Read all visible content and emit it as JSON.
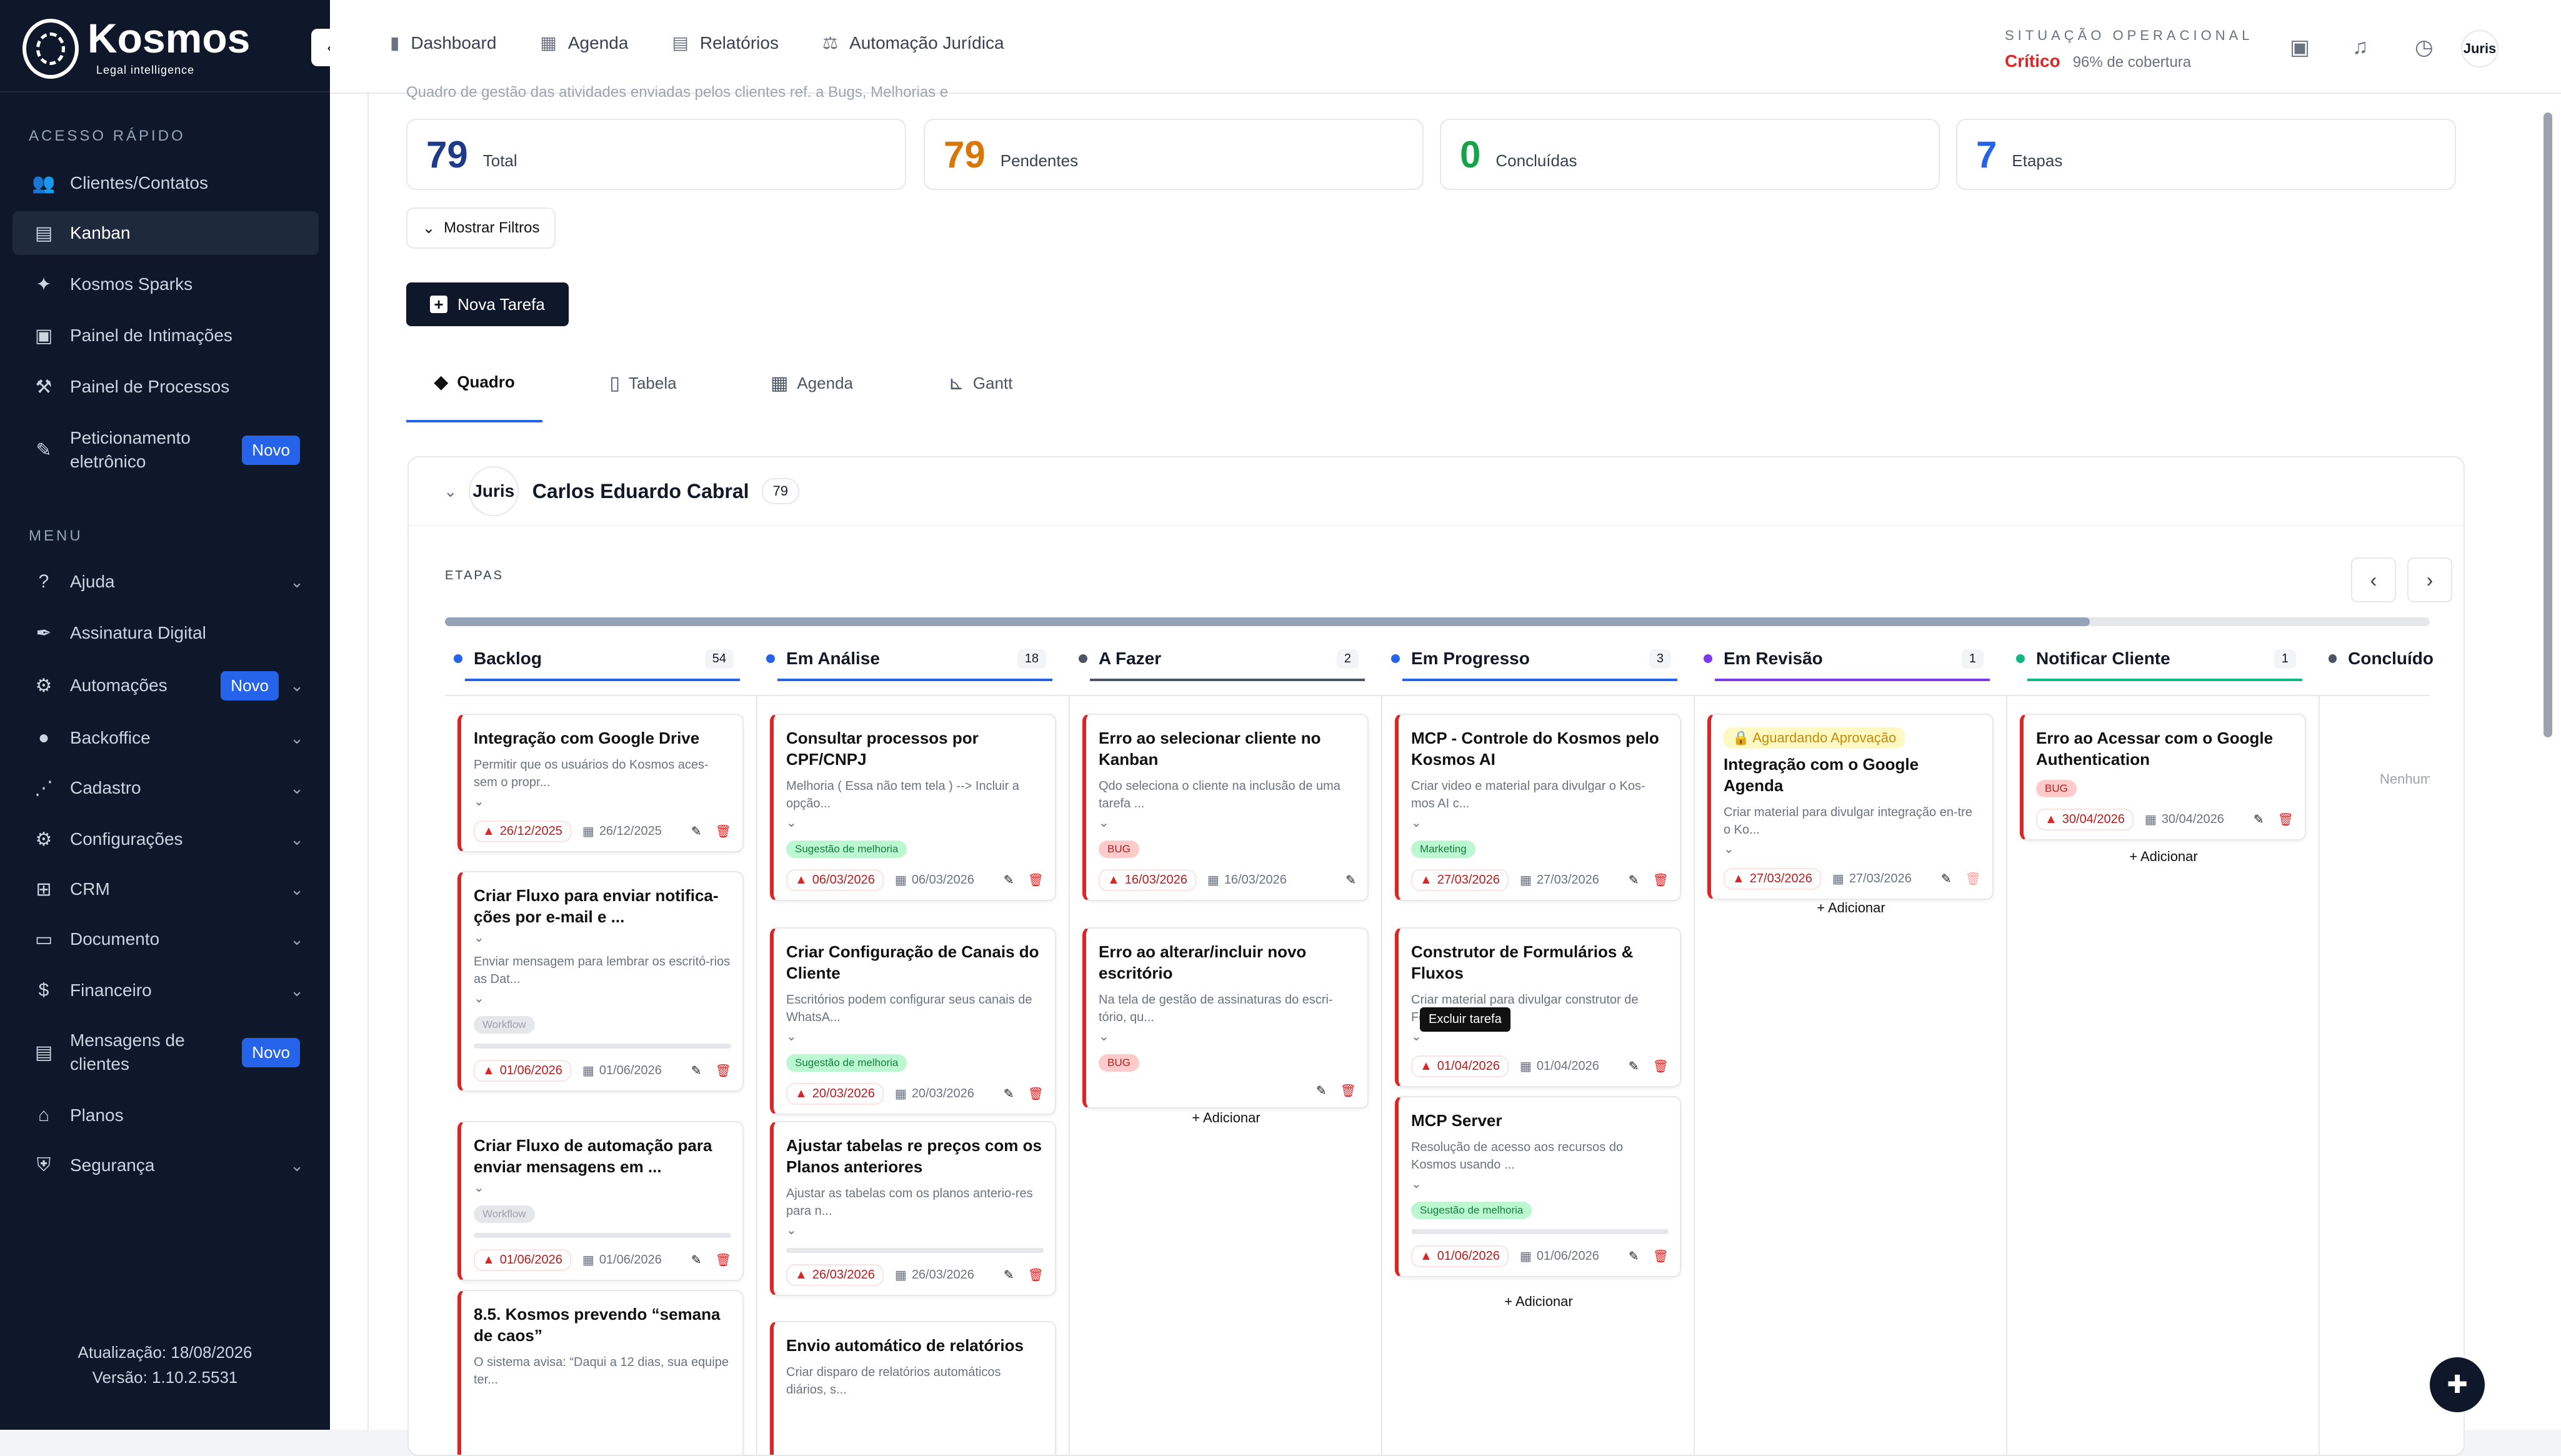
{
  "brand": {
    "name": "Kosmos",
    "tagline": "Legal intelligence"
  },
  "sidebar": {
    "quick_title": "ACESSO RÁPIDO",
    "quick": [
      {
        "label": "Clientes/Contatos",
        "icon": "users-icon"
      },
      {
        "label": "Kanban",
        "icon": "kanban-icon",
        "active": true
      },
      {
        "label": "Kosmos Sparks",
        "icon": "sparks-icon"
      },
      {
        "label": "Painel de Intimações",
        "icon": "notification-icon"
      },
      {
        "label": "Painel de Processos",
        "icon": "gavel-icon"
      },
      {
        "label": "Peticionamento eletrônico",
        "icon": "petition-icon",
        "badge": "Novo"
      }
    ],
    "menu_title": "MENU",
    "menu": [
      {
        "label": "Ajuda",
        "icon": "help-icon"
      },
      {
        "label": "Assinatura Digital",
        "icon": "pen-icon"
      },
      {
        "label": "Automações",
        "icon": "automation-icon",
        "badge": "Novo"
      },
      {
        "label": "Backoffice",
        "icon": "backoffice-icon"
      },
      {
        "label": "Cadastro",
        "icon": "cadastro-icon"
      },
      {
        "label": "Configurações",
        "icon": "settings-icon"
      },
      {
        "label": "CRM",
        "icon": "crm-icon"
      },
      {
        "label": "Documento",
        "icon": "document-icon"
      },
      {
        "label": "Financeiro",
        "icon": "money-icon"
      },
      {
        "label": "Mensagens de clientes",
        "icon": "messages-icon",
        "badge": "Novo"
      },
      {
        "label": "Planos",
        "icon": "plans-icon"
      },
      {
        "label": "Segurança",
        "icon": "shield-icon"
      }
    ],
    "footer": {
      "update": "Atualização: 18/08/2026",
      "version": "Versão: 1.10.2.5531"
    }
  },
  "topbar": {
    "nav": [
      {
        "label": "Dashboard",
        "icon": "chart-icon"
      },
      {
        "label": "Agenda",
        "icon": "calendar-icon"
      },
      {
        "label": "Relatórios",
        "icon": "report-icon"
      },
      {
        "label": "Automação Jurídica",
        "icon": "scale-icon"
      }
    ],
    "status_label": "SITUAÇÃO OPERACIONAL",
    "status_value": "Crítico",
    "coverage": "96% de cobertura",
    "avatar": "Juris"
  },
  "page": {
    "subdesc": "Quadro de gestão das atividades enviadas pelos clientes ref. a Bugs, Melhorias e",
    "stats": [
      {
        "num": "79",
        "label": "Total",
        "color": "#1e3a8a"
      },
      {
        "num": "79",
        "label": "Pendentes",
        "color": "#d97706"
      },
      {
        "num": "0",
        "label": "Concluídas",
        "color": "#16a34a"
      },
      {
        "num": "7",
        "label": "Etapas",
        "color": "#2563eb"
      }
    ],
    "filters_label": "Mostrar Filtros",
    "new_task_label": "Nova Tarefa",
    "view_tabs": [
      {
        "label": "Quadro",
        "icon": "layers-icon"
      },
      {
        "label": "Tabela",
        "icon": "table-icon"
      },
      {
        "label": "Agenda",
        "icon": "calendar-icon"
      },
      {
        "label": "Gantt",
        "icon": "gantt-icon"
      }
    ]
  },
  "board": {
    "owner": "Carlos Eduardo Cabral",
    "owner_avatar": "Juris",
    "owner_count": "79",
    "etapas_label": "ETAPAS",
    "add_label": "+ Adicionar",
    "empty_label": "Nenhum",
    "tooltip": "Excluir tarefa",
    "columns": [
      {
        "name": "Backlog",
        "count": "54",
        "color": "#2563eb"
      },
      {
        "name": "Em Análise",
        "count": "18",
        "color": "#2563eb"
      },
      {
        "name": "A Fazer",
        "count": "2",
        "color": "#4b5563"
      },
      {
        "name": "Em Progresso",
        "count": "3",
        "color": "#2563eb"
      },
      {
        "name": "Em Revisão",
        "count": "1",
        "color": "#7c3aed"
      },
      {
        "name": "Notificar Cliente",
        "count": "1",
        "color": "#10b981"
      },
      {
        "name": "Concluído",
        "count": "",
        "color": "#4b5563"
      }
    ],
    "cards": {
      "backlog": [
        {
          "title": "Integração com Google Drive",
          "desc": "Permitir que os usuários do Kosmos aces-sem o propr...",
          "due": "26/12/2025",
          "date": "26/12/2025"
        },
        {
          "title": "Criar Fluxo para enviar notifica-ções por e-mail e ...",
          "desc": "Enviar mensagem para lembrar os escritó-rios as Dat...",
          "tag": "Workflow",
          "due": "01/06/2026",
          "date": "01/06/2026"
        },
        {
          "title": "Criar Fluxo de automação para enviar mensagens em ...",
          "tag": "Workflow",
          "due": "01/06/2026",
          "date": "01/06/2026"
        },
        {
          "title": "8.5. Kosmos prevendo “semana de caos”",
          "desc": "O sistema avisa: “Daqui a 12 dias, sua equipe ter..."
        }
      ],
      "analise": [
        {
          "title": "Consultar processos por CPF/CNPJ",
          "desc": "Melhoria ( Essa não tem tela ) --> Incluir a opção...",
          "tag": "Sugestão de melhoria",
          "due": "06/03/2026",
          "date": "06/03/2026"
        },
        {
          "title": "Criar Configuração de Canais do Cliente",
          "desc": "Escritórios podem configurar seus canais de WhatsA...",
          "tag": "Sugestão de melhoria",
          "due": "20/03/2026",
          "date": "20/03/2026"
        },
        {
          "title": "Ajustar tabelas re preços com os Planos anteriores",
          "desc": "Ajustar as tabelas com os planos anterio-res para n...",
          "due": "26/03/2026",
          "date": "26/03/2026"
        },
        {
          "title": "Envio automático de relatórios",
          "desc": "Criar disparo de relatórios automáticos diários, s..."
        }
      ],
      "fazer": [
        {
          "title": "Erro ao selecionar cliente no Kanban",
          "desc": "Qdo seleciona o cliente na inclusão de uma tarefa ...",
          "tag": "BUG",
          "due": "16/03/2026",
          "date": "16/03/2026"
        },
        {
          "title": "Erro ao alterar/incluir novo escritório",
          "desc": "Na tela de gestão de assinaturas do escri-tório, qu...",
          "tag": "BUG"
        }
      ],
      "progresso": [
        {
          "title": "MCP - Controle do Kosmos pelo Kosmos AI",
          "desc": "Criar video e material para divulgar o Kos-mos AI c...",
          "tag": "Marketing",
          "due": "27/03/2026",
          "date": "27/03/2026"
        },
        {
          "title": "Construtor de Formulários & Fluxos",
          "desc": "Criar material para divulgar construtor de Formulá...",
          "due": "01/04/2026",
          "date": "01/04/2026"
        },
        {
          "title": "MCP Server",
          "desc": "Resolução de acesso aos recursos do Kosmos usando ...",
          "tag": "Sugestão de melhoria",
          "due": "01/06/2026",
          "date": "01/06/2026"
        }
      ],
      "revisao": [
        {
          "waiting": "Aguardando Aprovação",
          "title": "Integração com o Google Agenda",
          "desc": "Criar material para divulgar integração en-tre o Ko...",
          "due": "27/03/2026",
          "date": "27/03/2026"
        }
      ],
      "notificar": [
        {
          "title": "Erro ao Acessar com o Google Authentication",
          "tag": "BUG",
          "due": "30/04/2026",
          "date": "30/04/2026"
        }
      ]
    }
  }
}
